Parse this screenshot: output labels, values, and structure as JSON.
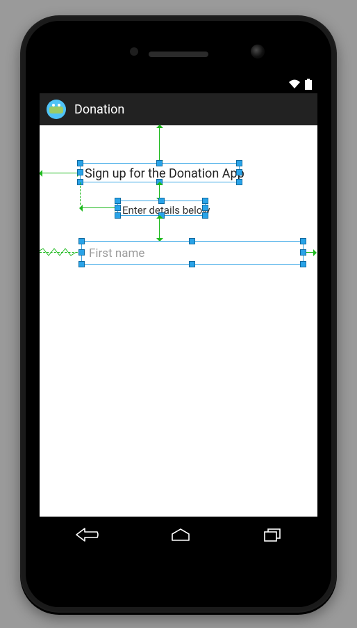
{
  "actionbar": {
    "title": "Donation"
  },
  "layout": {
    "heading": "Sign up for the Donation App",
    "subheading": "Enter details below",
    "first_name_placeholder": "First name"
  }
}
